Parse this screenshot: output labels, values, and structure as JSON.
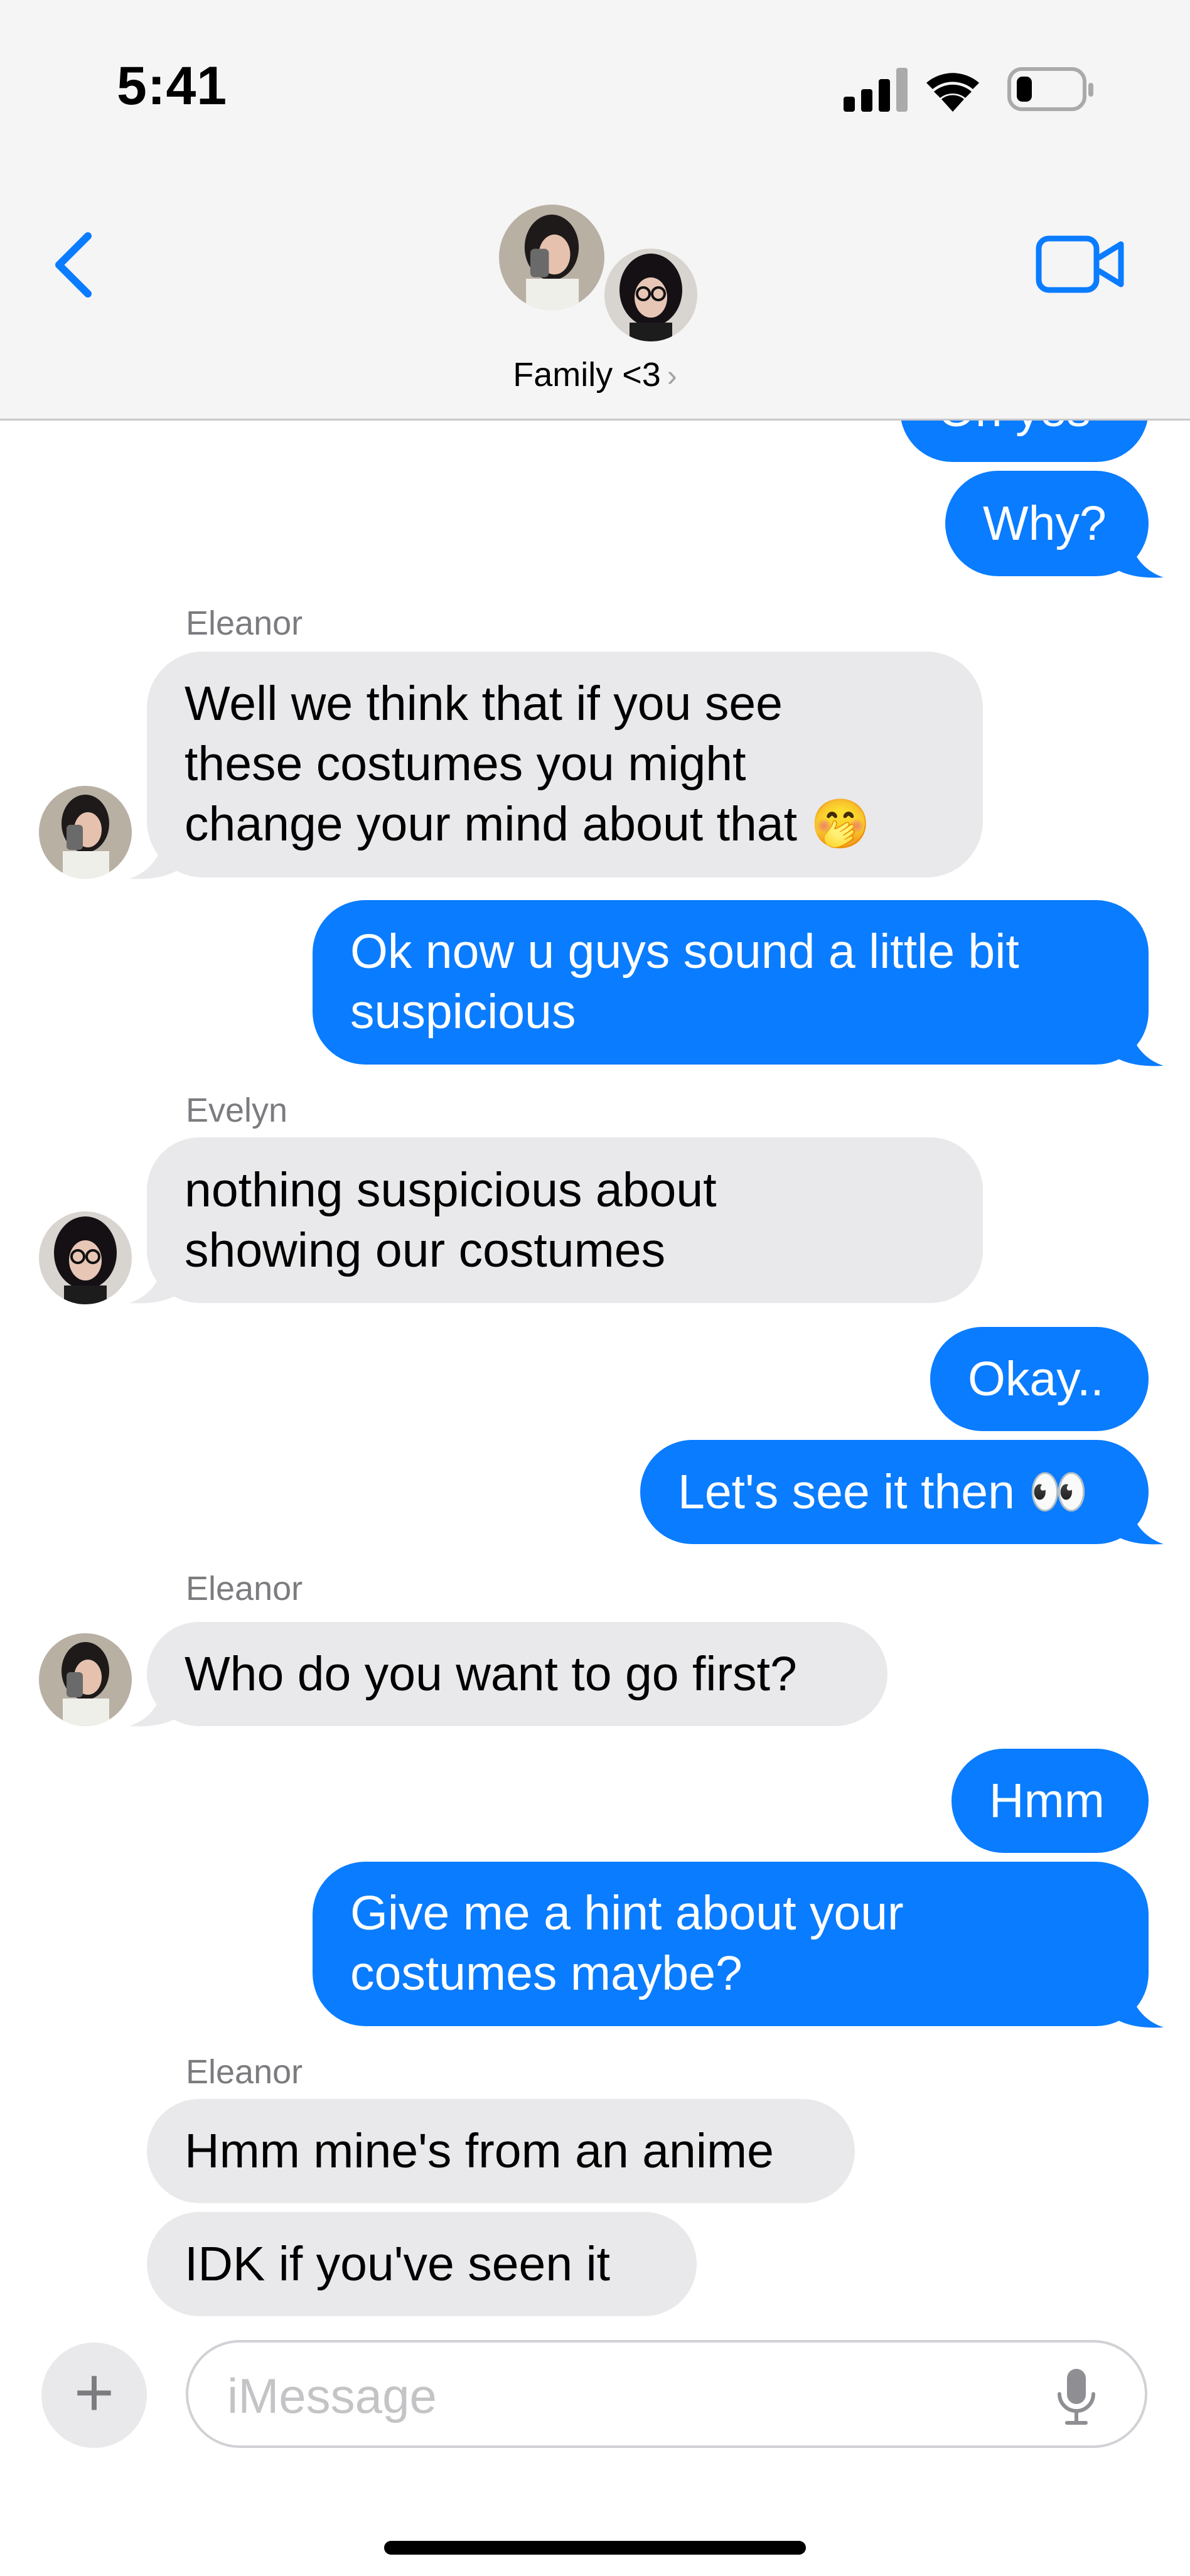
{
  "status_bar": {
    "time": "5:41",
    "battery_level": 0.25
  },
  "header": {
    "group_name": "Family <3",
    "chevron": "›",
    "back_icon": "chevron-left-icon",
    "video_icon": "video-camera-icon"
  },
  "messages": {
    "m0": "Oh yes",
    "m1": "Why?",
    "s2": "Eleanor",
    "m2": {
      "l1": "Well we think that if you see",
      "l2": "these costumes you might",
      "l3": "change your mind about that",
      "emoji": "🤭"
    },
    "m3": {
      "l1": "Ok now u guys sound a little bit",
      "l2": "suspicious"
    },
    "s4": "Evelyn",
    "m4": {
      "l1": "nothing suspicious about",
      "l2": "showing our costumes"
    },
    "m5": "Okay..",
    "m6": {
      "text": "Let's see it then",
      "emoji": "👀"
    },
    "s7": "Eleanor",
    "m7": "Who do you want to go first?",
    "m8": "Hmm",
    "m9": {
      "l1": "Give me a hint about your",
      "l2": "costumes maybe?"
    },
    "s10": "Eleanor",
    "m10": "Hmm mine's from an anime",
    "m11": "IDK if you've seen it"
  },
  "input": {
    "placeholder": "iMessage",
    "plus_label": "+",
    "mic_icon": "microphone-icon"
  },
  "colors": {
    "outgoing": "#0a7cff",
    "incoming": "#e9e9eb",
    "accent": "#0a7cff"
  }
}
